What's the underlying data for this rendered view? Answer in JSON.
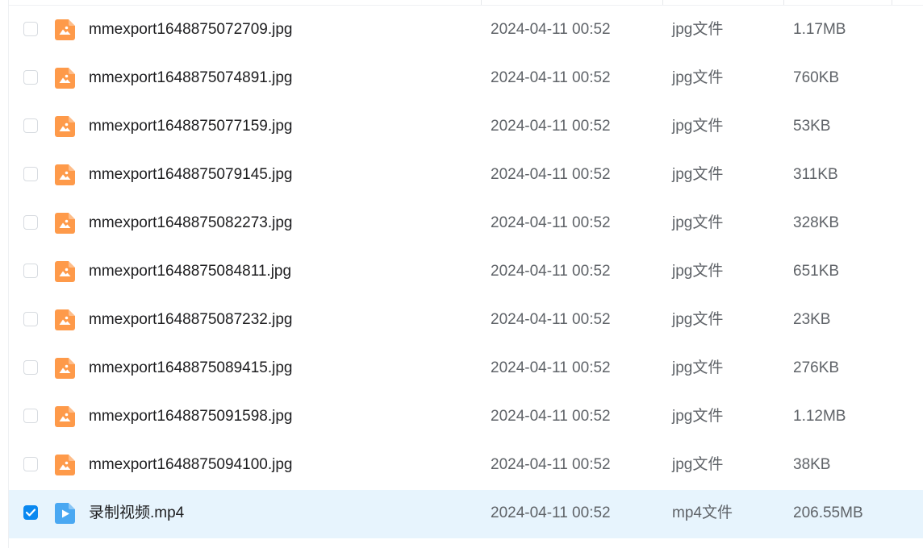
{
  "files": [
    {
      "name": "mmexport1648875072709.jpg",
      "date": "2024-04-11 00:52",
      "type": "jpg文件",
      "size": "1.17MB",
      "kind": "image",
      "checked": false
    },
    {
      "name": "mmexport1648875074891.jpg",
      "date": "2024-04-11 00:52",
      "type": "jpg文件",
      "size": "760KB",
      "kind": "image",
      "checked": false
    },
    {
      "name": "mmexport1648875077159.jpg",
      "date": "2024-04-11 00:52",
      "type": "jpg文件",
      "size": "53KB",
      "kind": "image",
      "checked": false
    },
    {
      "name": "mmexport1648875079145.jpg",
      "date": "2024-04-11 00:52",
      "type": "jpg文件",
      "size": "311KB",
      "kind": "image",
      "checked": false
    },
    {
      "name": "mmexport1648875082273.jpg",
      "date": "2024-04-11 00:52",
      "type": "jpg文件",
      "size": "328KB",
      "kind": "image",
      "checked": false
    },
    {
      "name": "mmexport1648875084811.jpg",
      "date": "2024-04-11 00:52",
      "type": "jpg文件",
      "size": "651KB",
      "kind": "image",
      "checked": false
    },
    {
      "name": "mmexport1648875087232.jpg",
      "date": "2024-04-11 00:52",
      "type": "jpg文件",
      "size": "23KB",
      "kind": "image",
      "checked": false
    },
    {
      "name": "mmexport1648875089415.jpg",
      "date": "2024-04-11 00:52",
      "type": "jpg文件",
      "size": "276KB",
      "kind": "image",
      "checked": false
    },
    {
      "name": "mmexport1648875091598.jpg",
      "date": "2024-04-11 00:52",
      "type": "jpg文件",
      "size": "1.12MB",
      "kind": "image",
      "checked": false
    },
    {
      "name": "mmexport1648875094100.jpg",
      "date": "2024-04-11 00:52",
      "type": "jpg文件",
      "size": "38KB",
      "kind": "image",
      "checked": false
    },
    {
      "name": "录制视频.mp4",
      "date": "2024-04-11 00:52",
      "type": "mp4文件",
      "size": "206.55MB",
      "kind": "video",
      "checked": true
    }
  ],
  "icons": {
    "image": "image-file-icon",
    "video": "video-file-icon",
    "check": "checkmark-icon"
  },
  "colors": {
    "image_icon": "#fe9a4a",
    "video_icon": "#4aa8f2",
    "selected_row": "#e7f4fd",
    "checkbox_checked": "#0a88f0"
  }
}
